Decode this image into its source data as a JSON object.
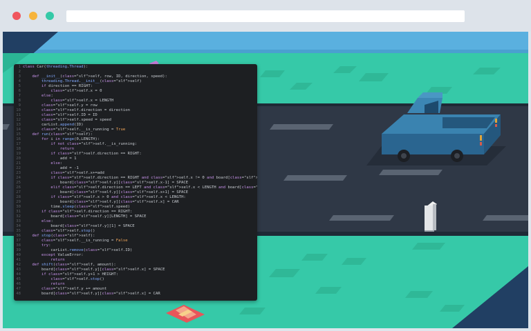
{
  "window": {
    "controls": [
      "close",
      "minimize",
      "maximize"
    ],
    "address_bar": ""
  },
  "code": {
    "lines": [
      "class Car(threading.Thread):",
      "",
      "    def __init__(self, row, ID, direction, speed):",
      "        threading.Thread.__init__(self)",
      "        if direction == RIGHT:",
      "            self.x = 0",
      "        else:",
      "            self.x = LENGTH",
      "        self.y = row",
      "        self.direction = direction",
      "        self.ID = ID",
      "        self.speed = speed",
      "        carList.append(ID)",
      "        self.__is_running = True",
      "    def run(self):",
      "        for i in range(0,LENGTH):",
      "            if not self.__is_running:",
      "                return",
      "            if self.direction == RIGHT:",
      "                add = 1",
      "            else:",
      "                add = -1",
      "            self.x+=add",
      "            if self.direction == RIGHT and self.x != 0 and board[self.y][self.x-1] == CAR:",
      "                board[self.y][self.x-1] = SPACE",
      "            elif self.direction == LEFT and self.x < LENGTH and board[self.y][self.x+1] == CAR:",
      "                board[self.y][self.x+1] = SPACE",
      "            if self.x > 0 and self.x < LENGTH:",
      "                board[self.y][self.x] = CAR",
      "            time.sleep(self.speed)",
      "        if self.direction == RIGHT:",
      "            board[self.y][LENGTH] = SPACE",
      "        else:",
      "            board[self.y][1] = SPACE",
      "        self.stop()",
      "    def stop(self):",
      "        self.__is_running = False",
      "        try:",
      "            carList.remove(self.ID)",
      "        except ValueError:",
      "            return",
      "    def shift(self, amount):",
      "        board[self.y][self.x] = SPACE",
      "        if self.y+1 > HEIGHT:",
      "            self.stop()",
      "            return",
      "        self.y += amount",
      "        board[self.y][self.x] = CAR"
    ]
  },
  "colors": {
    "sky": "#5ab0df",
    "grass": "#36c9a8",
    "road": "#2f3846",
    "truck": "#2f6e9a"
  }
}
